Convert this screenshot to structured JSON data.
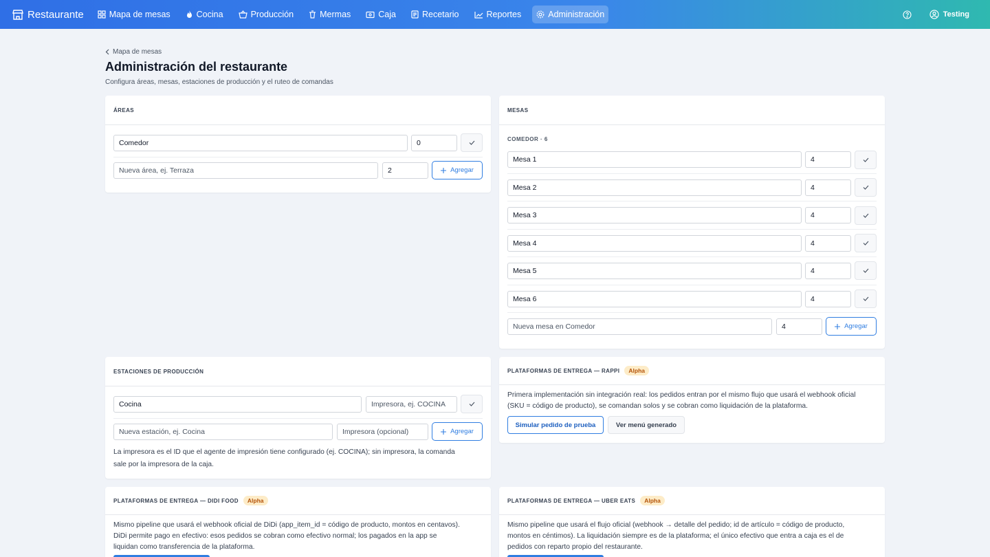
{
  "nav": {
    "brand": "Restaurante",
    "items": [
      {
        "label": "Mapa de mesas",
        "icon": "grid-icon"
      },
      {
        "label": "Cocina",
        "icon": "flame-icon"
      },
      {
        "label": "Producción",
        "icon": "basket-icon"
      },
      {
        "label": "Mermas",
        "icon": "trash-icon"
      },
      {
        "label": "Caja",
        "icon": "cash-icon"
      },
      {
        "label": "Recetario",
        "icon": "recipe-icon"
      },
      {
        "label": "Reportes",
        "icon": "chart-icon"
      },
      {
        "label": "Administración",
        "icon": "gear-icon",
        "active": true
      }
    ],
    "user": "Testing"
  },
  "header": {
    "breadcrumb": "Mapa de mesas",
    "title": "Administración del restaurante",
    "subtitle": "Configura áreas, mesas, estaciones de producción y el ruteo de comandas"
  },
  "areas": {
    "title": "ÁREAS",
    "rows": [
      {
        "name": "Comedor",
        "value": "0"
      }
    ],
    "new_placeholder": "Nueva área, ej. Terraza",
    "new_value": "2",
    "add_label": "Agregar"
  },
  "mesas": {
    "title": "MESAS",
    "group": "COMEDOR · 6",
    "rows": [
      {
        "name": "Mesa 1",
        "value": "4"
      },
      {
        "name": "Mesa 2",
        "value": "4"
      },
      {
        "name": "Mesa 3",
        "value": "4"
      },
      {
        "name": "Mesa 4",
        "value": "4"
      },
      {
        "name": "Mesa 5",
        "value": "4"
      },
      {
        "name": "Mesa 6",
        "value": "4"
      }
    ],
    "new_placeholder": "Nueva mesa en Comedor",
    "new_value": "4",
    "add_label": "Agregar"
  },
  "estaciones": {
    "title": "ESTACIONES DE PRODUCCIÓN",
    "rows": [
      {
        "name": "Cocina",
        "printer_placeholder": "Impresora, ej. COCINA"
      }
    ],
    "new_placeholder": "Nueva estación, ej. Cocina",
    "new_printer_placeholder": "Impresora (opcional)",
    "add_label": "Agregar",
    "help_line1": "La impresora es el ID que el agente de impresión tiene configurado (ej. COCINA); sin impresora, la comanda",
    "help_line2": "sale por la impresora de la caja."
  },
  "rappi": {
    "title": "PLATAFORMAS DE ENTREGA — RAPPI",
    "badge": "Alpha",
    "line1": "Primera implementación sin integración real: los pedidos entran por el mismo flujo que usará el webhook oficial",
    "line2": "(SKU = código de producto), se comandan solos y se cobran como liquidación de la plataforma.",
    "simulate_label": "Simular pedido de prueba",
    "menu_label": "Ver menú generado"
  },
  "didi": {
    "title": "PLATAFORMAS DE ENTREGA — DIDI FOOD",
    "badge": "Alpha",
    "line1": "Mismo pipeline que usará el webhook oficial de DiDi (app_item_id = código de producto, montos en centavos).",
    "line2": "DiDi permite pago en efectivo: esos pedidos se cobran como efectivo normal; los pagados en la app se",
    "line3": "liquidan como transferencia de la plataforma."
  },
  "uber": {
    "title": "PLATAFORMAS DE ENTREGA — UBER EATS",
    "badge": "Alpha",
    "line1": "Mismo pipeline que usará el flujo oficial (webhook → detalle del pedido; id de artículo = código de producto,",
    "line2": "montos en céntimos). La liquidación siempre es de la plataforma; el único efectivo que entra a caja es el de",
    "line3": "pedidos con reparto propio del restaurante."
  },
  "colors": {
    "accent": "#2f7de1",
    "badge_bg": "#fdecc8",
    "badge_text": "#b45309"
  }
}
